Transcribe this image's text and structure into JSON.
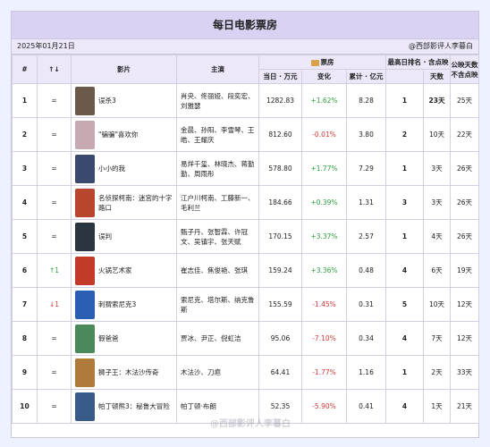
{
  "title": "每日电影票房",
  "date": "2025年01月21日",
  "author": "@西部影评人李暮白",
  "headers": {
    "num": "#",
    "arrow": "↑↓",
    "film": "影片",
    "cast": "主演",
    "boxoffice": "票房",
    "today": "当日 · 万元",
    "change": "变化",
    "total": "累计 · 亿元",
    "best_rank": "最高日排名 · 含点映",
    "days": "天数",
    "release_days": "公映天数 不含点映"
  },
  "rows": [
    {
      "num": "1",
      "trend": "=",
      "film": "误杀3",
      "cast": "肖央、佟丽娅、段奕宏、刘雅瑟",
      "today": "1282.83",
      "change": "+1.62%",
      "total": "8.28",
      "best": "1",
      "days": "23天",
      "rel": "25天",
      "poster": "#6b5a4a"
    },
    {
      "num": "2",
      "trend": "=",
      "film": "\"骗骗\"喜欢你",
      "cast": "金晨、孙阳、李雪琴、王皓、王耀庆",
      "today": "812.60",
      "change": "-0.01%",
      "total": "3.80",
      "best": "2",
      "days": "10天",
      "rel": "22天",
      "poster": "#c7a9b1"
    },
    {
      "num": "3",
      "trend": "=",
      "film": "小小的我",
      "cast": "易烊千玺、林晓杰、蒋勤勤、周雨彤",
      "today": "578.80",
      "change": "+1.77%",
      "total": "7.29",
      "best": "1",
      "days": "3天",
      "rel": "26天",
      "poster": "#3a4a6e"
    },
    {
      "num": "4",
      "trend": "=",
      "film": "名侦探柯南：迷宫的十字路口",
      "cast": "江户川柯南、工藤新一、毛利兰",
      "today": "184.66",
      "change": "+0.39%",
      "total": "1.31",
      "best": "3",
      "days": "3天",
      "rel": "26天",
      "poster": "#b8452e"
    },
    {
      "num": "5",
      "trend": "=",
      "film": "误判",
      "cast": "甄子丹、张智霖、许冠文、吴镇宇、张天赋",
      "today": "170.15",
      "change": "+3.37%",
      "total": "2.57",
      "best": "1",
      "days": "4天",
      "rel": "26天",
      "poster": "#2b3540"
    },
    {
      "num": "6",
      "trend": "↑1",
      "film": "火锅艺术家",
      "cast": "崔志佳、焦俊艳、张琪",
      "today": "159.24",
      "change": "+3.36%",
      "total": "0.48",
      "best": "4",
      "days": "6天",
      "rel": "19天",
      "poster": "#c23a2a"
    },
    {
      "num": "7",
      "trend": "↓1",
      "film": "刺猬索尼克3",
      "cast": "索尼克、塔尔斯、纳克鲁斯",
      "today": "155.59",
      "change": "-1.45%",
      "total": "0.31",
      "best": "5",
      "days": "10天",
      "rel": "12天",
      "poster": "#2a5fb3"
    },
    {
      "num": "8",
      "trend": "=",
      "film": "假爸爸",
      "cast": "贾冰、尹正、倪虹洁",
      "today": "95.06",
      "change": "-7.10%",
      "total": "0.34",
      "best": "4",
      "days": "7天",
      "rel": "12天",
      "poster": "#4a8a5a"
    },
    {
      "num": "9",
      "trend": "=",
      "film": "狮子王：木法沙传奇",
      "cast": "木法沙、刀疤",
      "today": "64.41",
      "change": "-1.77%",
      "total": "1.16",
      "best": "1",
      "days": "2天",
      "rel": "33天",
      "poster": "#b07a3a"
    },
    {
      "num": "10",
      "trend": "=",
      "film": "帕丁顿熊3：秘鲁大冒险",
      "cast": "帕丁顿·布朗",
      "today": "52.35",
      "change": "-5.90%",
      "total": "0.41",
      "best": "4",
      "days": "1天",
      "rel": "21天",
      "poster": "#3a5a8a"
    }
  ],
  "watermark": "@西部影评人李暮白"
}
